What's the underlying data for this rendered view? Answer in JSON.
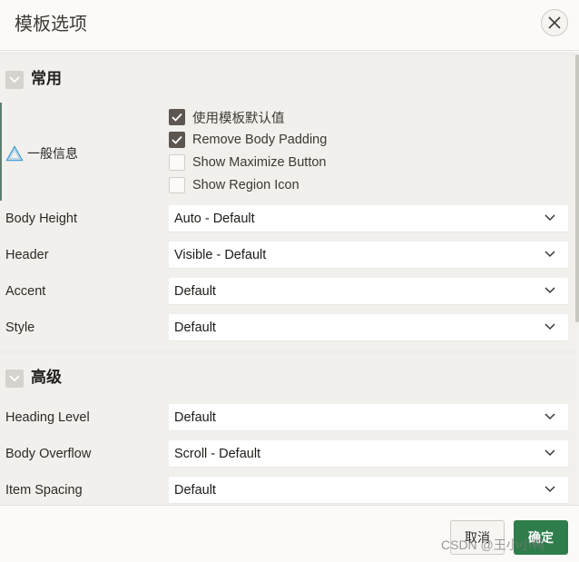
{
  "dialog": {
    "title": "模板选项",
    "close_label": "×"
  },
  "sections": {
    "common": {
      "title": "常用",
      "group": {
        "label": "一般信息",
        "options": [
          {
            "label": "使用模板默认值",
            "checked": true
          },
          {
            "label": "Remove Body Padding",
            "checked": true
          },
          {
            "label": "Show Maximize Button",
            "checked": false
          },
          {
            "label": "Show Region Icon",
            "checked": false
          }
        ]
      },
      "fields": [
        {
          "label": "Body Height",
          "value": "Auto - Default"
        },
        {
          "label": "Header",
          "value": "Visible - Default"
        },
        {
          "label": "Accent",
          "value": "Default"
        },
        {
          "label": "Style",
          "value": "Default"
        }
      ]
    },
    "advanced": {
      "title": "高级",
      "fields": [
        {
          "label": "Heading Level",
          "value": "Default"
        },
        {
          "label": "Body Overflow",
          "value": "Scroll - Default"
        },
        {
          "label": "Item Spacing",
          "value": "Default"
        }
      ]
    }
  },
  "footer": {
    "cancel_label": "取消",
    "ok_label": "确定"
  },
  "watermark": "CSDN @王小小鸭",
  "icons": {
    "close": "close-icon",
    "section_toggle": "chevron-down-icon",
    "select_chevron": "chevron-down-icon",
    "checkmark": "check-icon",
    "group_warning": "warning-triangle-icon"
  },
  "colors": {
    "primary_button": "#2f7d4b",
    "checkbox_checked": "#5d5650",
    "group_accent": "#5f7d6f",
    "warning_icon": "#4a9fd4"
  }
}
